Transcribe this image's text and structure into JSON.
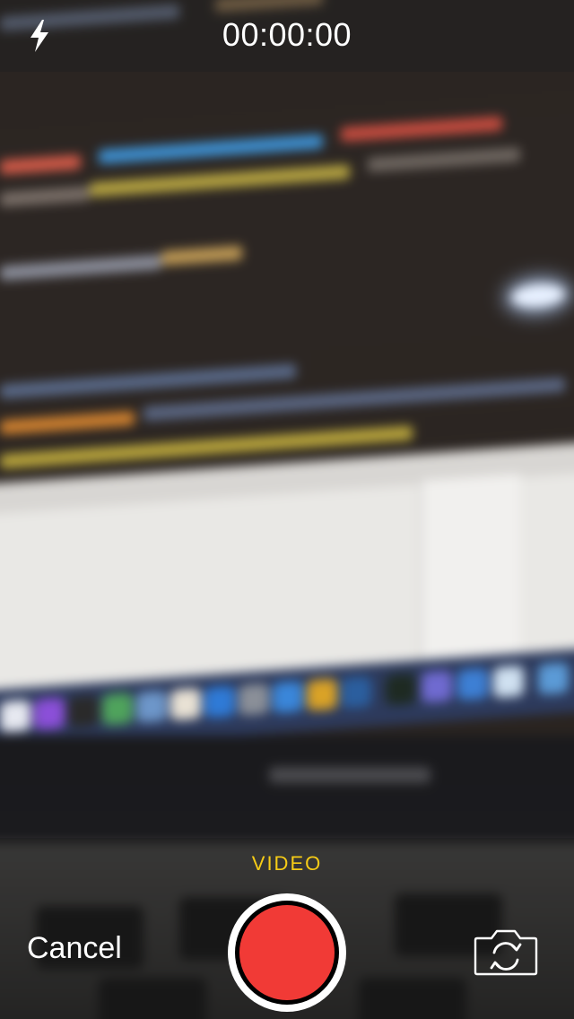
{
  "top_bar": {
    "flash_icon": "lightning-bolt-icon",
    "timer": "00:00:00"
  },
  "bottom_bar": {
    "mode": "VIDEO",
    "cancel_label": "Cancel",
    "record_icon": "record-button",
    "flip_icon": "camera-flip-icon"
  },
  "colors": {
    "mode_accent": "#f7cc16",
    "record_red": "#f13a36",
    "text": "#ffffff"
  }
}
